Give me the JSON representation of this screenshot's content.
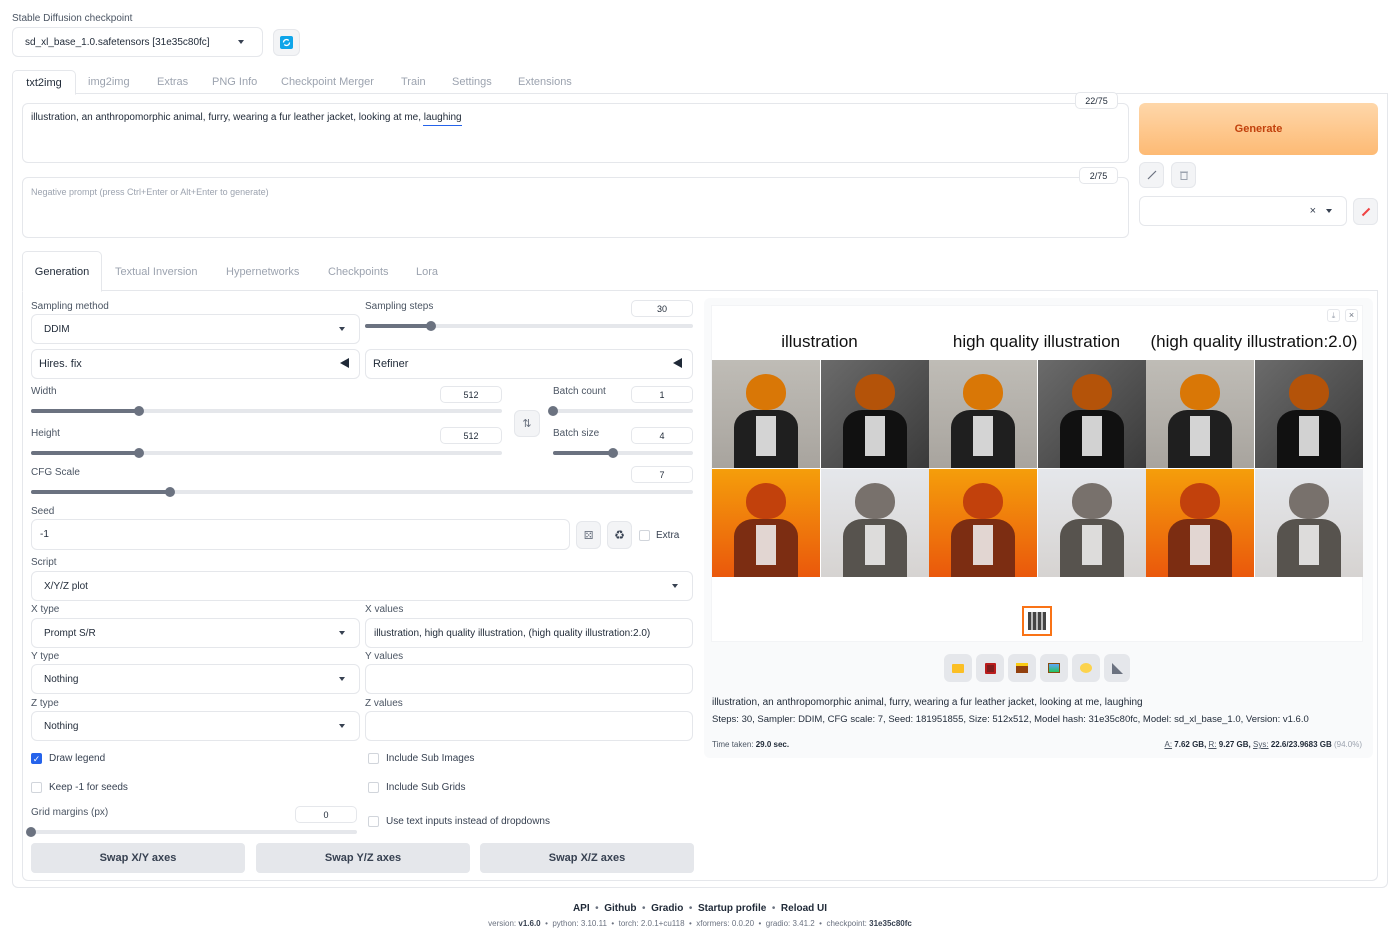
{
  "checkpoint": {
    "label": "Stable Diffusion checkpoint",
    "value": "sd_xl_base_1.0.safetensors [31e35c80fc]"
  },
  "main_tabs": [
    "txt2img",
    "img2img",
    "Extras",
    "PNG Info",
    "Checkpoint Merger",
    "Train",
    "Settings",
    "Extensions"
  ],
  "prompt": {
    "text": "illustration, an anthropomorphic animal, furry, wearing a fur leather jacket, looking at me, laughing",
    "counter": "22/75"
  },
  "negative": {
    "placeholder": "Negative prompt (press Ctrl+Enter or Alt+Enter to generate)",
    "counter": "2/75"
  },
  "generate_label": "Generate",
  "sub_tabs": [
    "Generation",
    "Textual Inversion",
    "Hypernetworks",
    "Checkpoints",
    "Lora"
  ],
  "sampling": {
    "method_label": "Sampling method",
    "method": "DDIM",
    "steps_label": "Sampling steps",
    "steps": "30",
    "steps_fraction": 0.2
  },
  "hires_label": "Hires. fix",
  "refiner_label": "Refiner",
  "width": {
    "label": "Width",
    "value": "512",
    "fraction": 0.23
  },
  "height": {
    "label": "Height",
    "value": "512",
    "fraction": 0.23
  },
  "batch_count": {
    "label": "Batch count",
    "value": "1",
    "fraction": 0.0
  },
  "batch_size": {
    "label": "Batch size",
    "value": "4",
    "fraction": 0.43
  },
  "cfg": {
    "label": "CFG Scale",
    "value": "7",
    "fraction": 0.21
  },
  "seed": {
    "label": "Seed",
    "value": "-1",
    "extra_label": "Extra"
  },
  "script": {
    "label": "Script",
    "value": "X/Y/Z plot"
  },
  "xtype": {
    "label": "X type",
    "value": "Prompt S/R"
  },
  "xvalues": {
    "label": "X values",
    "value": "illustration, high quality illustration, (high quality illustration:2.0)"
  },
  "ytype": {
    "label": "Y type",
    "value": "Nothing"
  },
  "yvalues": {
    "label": "Y values"
  },
  "ztype": {
    "label": "Z type",
    "value": "Nothing"
  },
  "zvalues": {
    "label": "Z values"
  },
  "checks": {
    "draw_legend": "Draw legend",
    "keep_seeds": "Keep -1 for seeds",
    "sub_images": "Include Sub Images",
    "sub_grids": "Include Sub Grids",
    "text_inputs": "Use text inputs instead of dropdowns"
  },
  "grid_margins": {
    "label": "Grid margins (px)",
    "value": "0",
    "fraction": 0.0
  },
  "swap": {
    "xy": "Swap X/Y axes",
    "yz": "Swap Y/Z axes",
    "xz": "Swap X/Z axes"
  },
  "grid_headers": [
    "illustration",
    "high quality illustration",
    "(high quality illustration:2.0)"
  ],
  "info": {
    "prompt": "illustration, an anthropomorphic animal, furry, wearing a fur leather jacket, looking at me, laughing",
    "params": "Steps: 30, Sampler: DDIM, CFG scale: 7, Seed: 181951855, Size: 512x512, Model hash: 31e35c80fc, Model: sd_xl_base_1.0, Version: v1.6.0",
    "time_label": "Time taken:",
    "time_value": "29.0 sec.",
    "mem_a_label": "A:",
    "mem_a": "7.62 GB,",
    "mem_r_label": "R:",
    "mem_r": "9.27 GB,",
    "mem_sys_label": "Sys:",
    "mem_sys": "22.6/23.9683 GB",
    "mem_pct": "(94.0%)"
  },
  "footer": {
    "links": [
      "API",
      "Github",
      "Gradio",
      "Startup profile",
      "Reload UI"
    ],
    "version_label": "version:",
    "version": "v1.6.0",
    "python_label": "python:",
    "python": "3.10.11",
    "torch_label": "torch:",
    "torch": "2.0.1+cu118",
    "xformers_label": "xformers:",
    "xformers": "0.0.20",
    "gradio_label": "gradio:",
    "gradio": "3.41.2",
    "checkpoint_label": "checkpoint:",
    "checkpoint": "31e35c80fc"
  },
  "colors": {
    "accent": "#f97316",
    "generate_bg": "#fdba74",
    "blue": "#2563eb"
  }
}
